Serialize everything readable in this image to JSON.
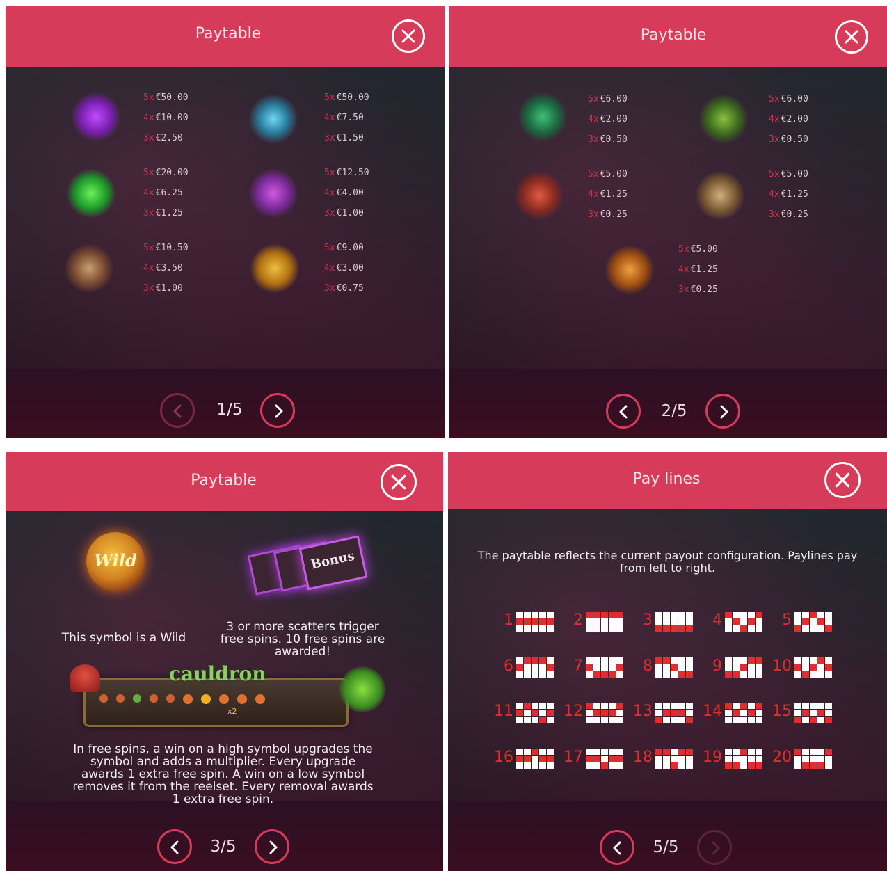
{
  "colors": {
    "header": "#d63c5a",
    "accent_red": "#e02e2e",
    "multiplier": "#c8384f",
    "text": "#f2eef0"
  },
  "panels": {
    "p1": {
      "title": "Paytable",
      "symbols": [
        {
          "icon": "bonus-scatter-icon",
          "pays": [
            {
              "mult": "5x",
              "amount": "€50.00"
            },
            {
              "mult": "4x",
              "amount": "€10.00"
            },
            {
              "mult": "3x",
              "amount": "€2.50"
            }
          ]
        },
        {
          "icon": "spider-flower-icon",
          "pays": [
            {
              "mult": "5x",
              "amount": "€50.00"
            },
            {
              "mult": "4x",
              "amount": "€7.50"
            },
            {
              "mult": "3x",
              "amount": "€1.50"
            }
          ]
        },
        {
          "icon": "green-toad-icon",
          "pays": [
            {
              "mult": "5x",
              "amount": "€20.00"
            },
            {
              "mult": "4x",
              "amount": "€6.25"
            },
            {
              "mult": "3x",
              "amount": "€1.25"
            }
          ]
        },
        {
          "icon": "purple-bat-icon",
          "pays": [
            {
              "mult": "5x",
              "amount": "€12.50"
            },
            {
              "mult": "4x",
              "amount": "€4.00"
            },
            {
              "mult": "3x",
              "amount": "€1.00"
            }
          ]
        },
        {
          "icon": "brain-plant-icon",
          "pays": [
            {
              "mult": "5x",
              "amount": "€10.50"
            },
            {
              "mult": "4x",
              "amount": "€3.50"
            },
            {
              "mult": "3x",
              "amount": "€1.00"
            }
          ]
        },
        {
          "icon": "wasp-icon",
          "pays": [
            {
              "mult": "5x",
              "amount": "€9.00"
            },
            {
              "mult": "4x",
              "amount": "€3.00"
            },
            {
              "mult": "3x",
              "amount": "€0.75"
            }
          ]
        }
      ],
      "page": "1/5"
    },
    "p2": {
      "title": "Paytable",
      "symbols": [
        {
          "icon": "eye-leaf-icon",
          "pays": [
            {
              "mult": "5x",
              "amount": "€6.00"
            },
            {
              "mult": "4x",
              "amount": "€2.00"
            },
            {
              "mult": "3x",
              "amount": "€0.50"
            }
          ]
        },
        {
          "icon": "flytrap-icon",
          "pays": [
            {
              "mult": "5x",
              "amount": "€6.00"
            },
            {
              "mult": "4x",
              "amount": "€2.00"
            },
            {
              "mult": "3x",
              "amount": "€0.50"
            }
          ]
        },
        {
          "icon": "mushroom-icon",
          "pays": [
            {
              "mult": "5x",
              "amount": "€5.00"
            },
            {
              "mult": "4x",
              "amount": "€1.25"
            },
            {
              "mult": "3x",
              "amount": "€0.25"
            }
          ]
        },
        {
          "icon": "root-icon",
          "pays": [
            {
              "mult": "5x",
              "amount": "€5.00"
            },
            {
              "mult": "4x",
              "amount": "€1.25"
            },
            {
              "mult": "3x",
              "amount": "€0.25"
            }
          ]
        },
        {
          "icon": "potion-bowl-icon",
          "pays": [
            {
              "mult": "5x",
              "amount": "€5.00"
            },
            {
              "mult": "4x",
              "amount": "€1.25"
            },
            {
              "mult": "3x",
              "amount": "€0.25"
            }
          ]
        }
      ],
      "page": "2/5"
    },
    "p3": {
      "title": "Paytable",
      "wild_logo": "Wild",
      "wild_text": "This symbol is a Wild",
      "bonus_logo": "Bonus",
      "bonus_text": "3 or more scatters trigger free spins. 10 free spins are awarded!",
      "cauldron_logo": "cauldron",
      "cauldron_mult": "x2",
      "freespins_text": "In free spins, a win on a high symbol upgrades the symbol and adds a multiplier. Every upgrade awards 1 extra free spin. A win on a low symbol removes it from the reelset. Every removal awards 1 extra free spin.",
      "page": "3/5"
    },
    "p4": {
      "title": "Pay lines",
      "intro": "The paytable reflects the current payout configuration. Paylines pay from left to right.",
      "paylines": [
        {
          "n": "1",
          "rows": [
            1,
            1,
            1,
            1,
            1
          ]
        },
        {
          "n": "2",
          "rows": [
            0,
            0,
            0,
            0,
            0
          ]
        },
        {
          "n": "3",
          "rows": [
            2,
            2,
            2,
            2,
            2
          ]
        },
        {
          "n": "4",
          "rows": [
            0,
            1,
            2,
            1,
            0
          ]
        },
        {
          "n": "5",
          "rows": [
            2,
            1,
            0,
            1,
            2
          ]
        },
        {
          "n": "6",
          "rows": [
            1,
            0,
            0,
            0,
            1
          ]
        },
        {
          "n": "7",
          "rows": [
            1,
            2,
            2,
            2,
            1
          ]
        },
        {
          "n": "8",
          "rows": [
            0,
            0,
            1,
            2,
            2
          ]
        },
        {
          "n": "9",
          "rows": [
            2,
            2,
            1,
            0,
            0
          ]
        },
        {
          "n": "10",
          "rows": [
            1,
            2,
            1,
            0,
            1
          ]
        },
        {
          "n": "11",
          "rows": [
            1,
            0,
            1,
            2,
            1
          ]
        },
        {
          "n": "12",
          "rows": [
            0,
            1,
            1,
            1,
            0
          ]
        },
        {
          "n": "13",
          "rows": [
            2,
            1,
            1,
            1,
            2
          ]
        },
        {
          "n": "14",
          "rows": [
            0,
            1,
            0,
            1,
            0
          ]
        },
        {
          "n": "15",
          "rows": [
            2,
            1,
            2,
            1,
            2
          ]
        },
        {
          "n": "16",
          "rows": [
            1,
            1,
            0,
            1,
            1
          ]
        },
        {
          "n": "17",
          "rows": [
            1,
            1,
            2,
            1,
            1
          ]
        },
        {
          "n": "18",
          "rows": [
            0,
            0,
            2,
            0,
            0
          ]
        },
        {
          "n": "19",
          "rows": [
            2,
            2,
            0,
            2,
            2
          ]
        },
        {
          "n": "20",
          "rows": [
            0,
            2,
            2,
            2,
            0
          ]
        }
      ],
      "page": "5/5"
    }
  }
}
